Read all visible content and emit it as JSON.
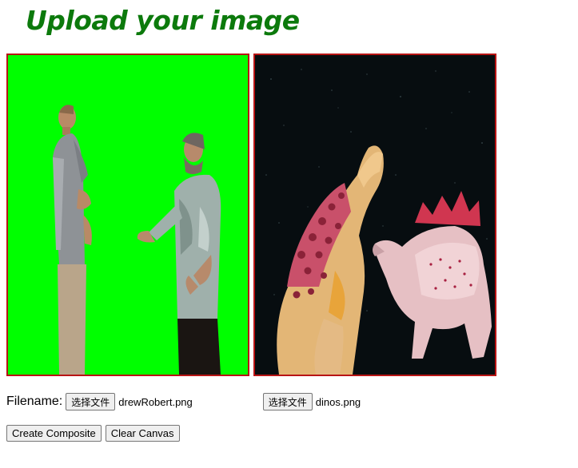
{
  "page": {
    "title": "Upload your image"
  },
  "canvases": {
    "foreground": {
      "background_color": "#00ff00",
      "border_color": "#b81414"
    },
    "background": {
      "background_color": "#070d10",
      "border_color": "#b81414"
    }
  },
  "file_inputs": {
    "label": "Filename:",
    "foreground": {
      "button_label": "选择文件",
      "file_name": "drewRobert.png"
    },
    "background": {
      "button_label": "选择文件",
      "file_name": "dinos.png"
    }
  },
  "actions": {
    "create_label": "Create Composite",
    "clear_label": "Clear Canvas"
  }
}
